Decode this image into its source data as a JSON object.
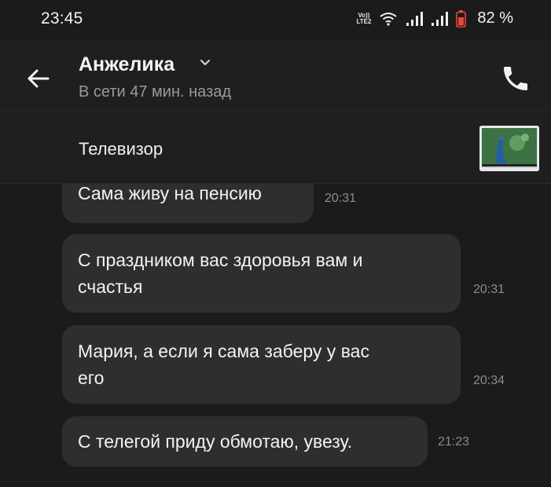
{
  "status_bar": {
    "time": "23:45",
    "volte_top": "Vo))",
    "volte_bottom": "LTE2",
    "battery": "82 %",
    "battery_color": "#e9473b"
  },
  "header": {
    "contact_name": "Анжелика",
    "last_seen": "В сети 47 мин. назад"
  },
  "product": {
    "title": "Телевизор"
  },
  "messages": [
    {
      "text_lines": [
        "Сама живу на пенсию"
      ],
      "time": "20:31"
    },
    {
      "text_lines": [
        "С праздником вас здоровья вам и",
        "счастья"
      ],
      "time": "20:31"
    },
    {
      "text_lines": [
        "Мария, а если я сама заберу у вас",
        "его"
      ],
      "time": "20:34"
    },
    {
      "text_lines": [
        "С телегой приду обмотаю, увезу."
      ],
      "time": "21:23"
    }
  ],
  "colors": {
    "background": "#1b1b1b",
    "bubble": "#2e2e2e",
    "secondary_text": "#9a9a9a"
  }
}
